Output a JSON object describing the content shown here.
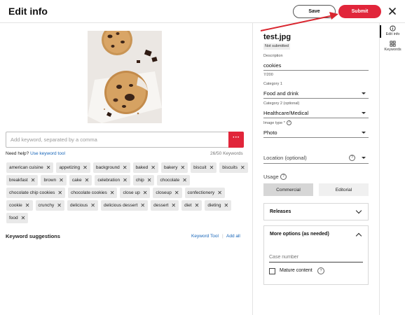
{
  "header": {
    "title": "Edit info",
    "save_label": "Save",
    "submit_label": "Submit",
    "close_icon": "close-icon"
  },
  "image": {
    "subject": "cookies"
  },
  "keywords": {
    "input_placeholder": "Add keyword, separated by a comma",
    "more_icon": "more-icon",
    "help_prefix": "Need help?",
    "help_link": "Use keyword tool",
    "count": "26/50 Keywords",
    "chips": [
      "american cuisine",
      "appetizing",
      "background",
      "baked",
      "bakery",
      "biscuit",
      "biscuits",
      "breakfast",
      "brown",
      "cake",
      "celebration",
      "chip",
      "chocolate",
      "chocolate chip cookies",
      "chocolate cookies",
      "close up",
      "closeup",
      "confectionery",
      "cookie",
      "crunchy",
      "delicious",
      "delicious dessert",
      "dessert",
      "diet",
      "dieting",
      "food"
    ],
    "suggestions_title": "Keyword suggestions",
    "keyword_tool_link": "Keyword Tool",
    "add_all_link": "Add all"
  },
  "details": {
    "filename": "test.jpg",
    "status": "Not submitted",
    "description_label": "Description",
    "description_value": "cookies",
    "description_count": "7/200",
    "category1_label": "Category 1",
    "category1_value": "Food and drink",
    "category2_label": "Category 2 (optional)",
    "category2_value": "Healthcare/Medical",
    "image_type_label": "Image type *",
    "image_type_value": "Photo",
    "location_placeholder": "Location (optional)",
    "usage_label": "Usage",
    "usage_commercial": "Commercial",
    "usage_editorial": "Editorial",
    "usage_selected": "Commercial",
    "releases_label": "Releases",
    "more_options_label": "More options (as needed)",
    "case_number_placeholder": "Case number",
    "mature_content_label": "Mature content",
    "help_symbol": "?"
  },
  "rail": {
    "edit_info_label": "Edit info",
    "keywords_label": "Keywords"
  },
  "colors": {
    "brand_red": "#e1253a",
    "link_blue": "#1765b8"
  }
}
